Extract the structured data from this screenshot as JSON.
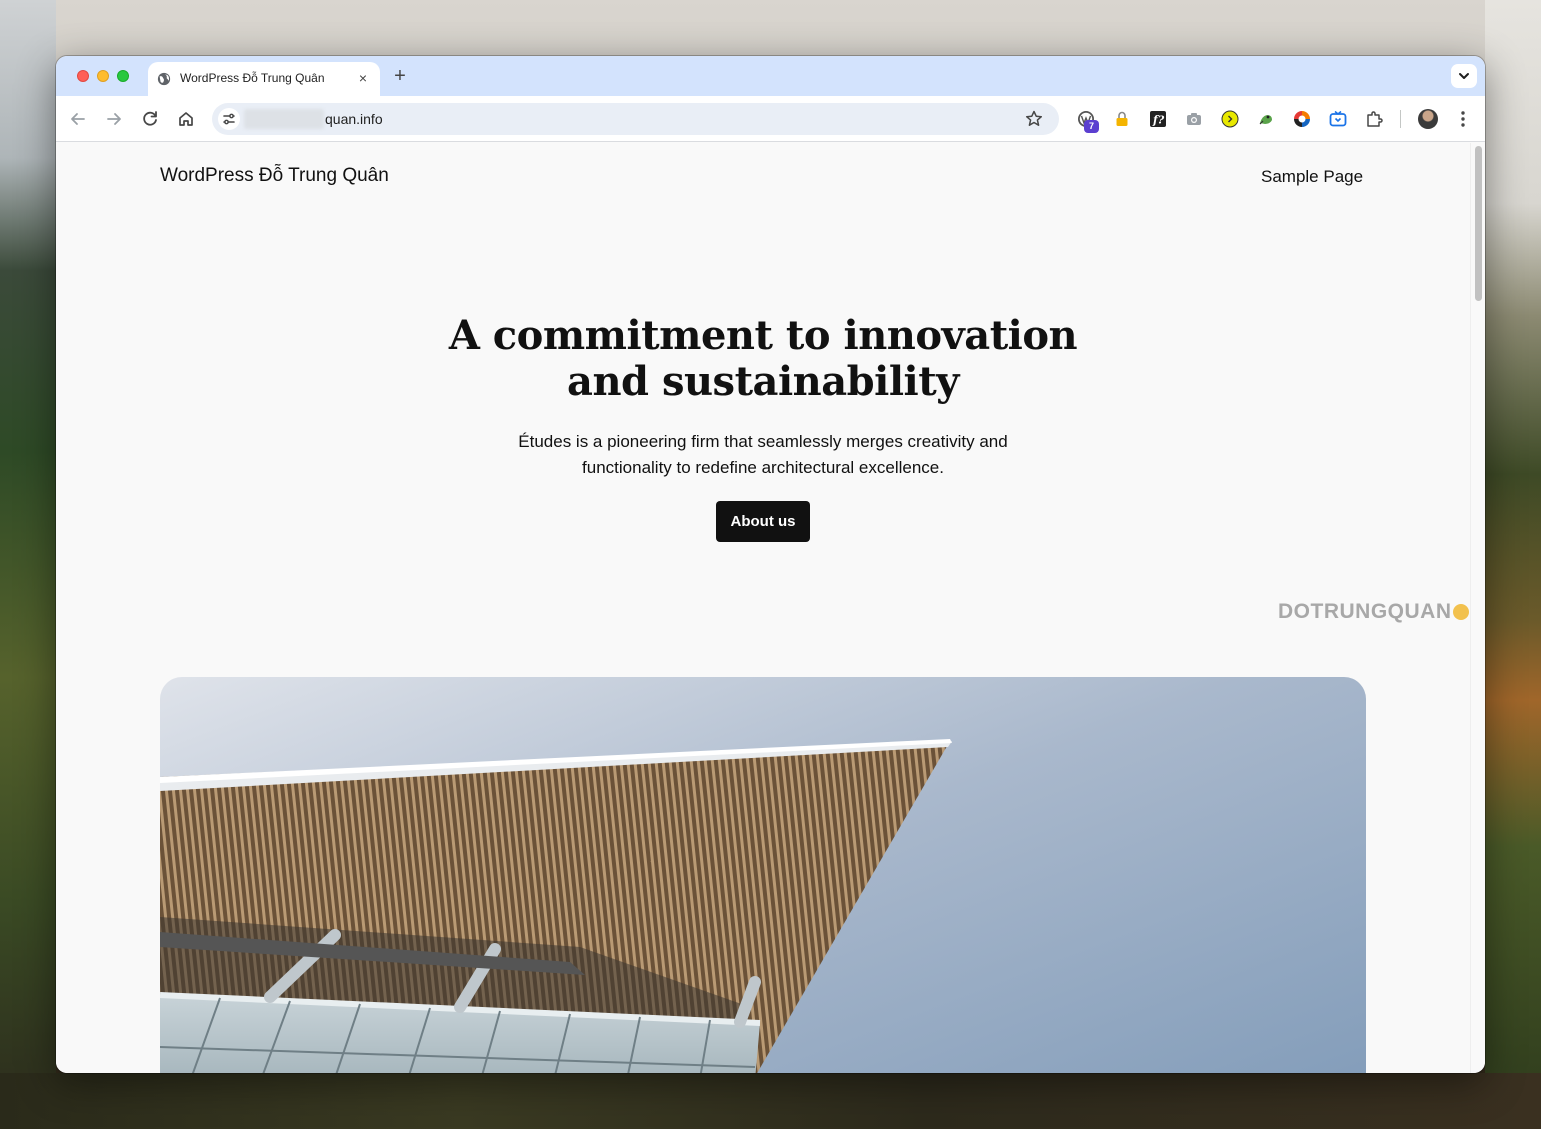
{
  "browser": {
    "tab_title": "WordPress Đỗ Trung Quân",
    "tab_close": "×",
    "new_tab": "+",
    "url_visible": "quan.info",
    "extension_badge": "7"
  },
  "site": {
    "title": "WordPress Đỗ Trung Quân",
    "nav": {
      "sample_page": "Sample Page"
    }
  },
  "hero": {
    "heading_line1": "A commitment to innovation",
    "heading_line2": "and sustainability",
    "subtext_line1": "Études is a pioneering firm that seamlessly merges creativity and",
    "subtext_line2": "functionality to redefine architectural excellence.",
    "button_label": "About us"
  },
  "watermark": {
    "text": "DOTRUNGQUAN"
  },
  "colors": {
    "tabbar_bg": "#d3e3fd",
    "page_bg": "#f9f9f9",
    "button_bg": "#111111",
    "button_text": "#ffffff"
  },
  "icons": [
    "back-icon",
    "forward-icon",
    "reload-icon",
    "home-icon",
    "site-settings-icon",
    "bookmark-star-icon",
    "wordpress-extension-icon",
    "lock-extension-icon",
    "font-extension-icon",
    "camera-extension-icon",
    "arrow-circle-extension-icon",
    "frog-extension-icon",
    "colorful-extension-icon",
    "tv-extension-icon",
    "puzzle-icon",
    "profile-avatar",
    "kebab-menu-icon"
  ]
}
